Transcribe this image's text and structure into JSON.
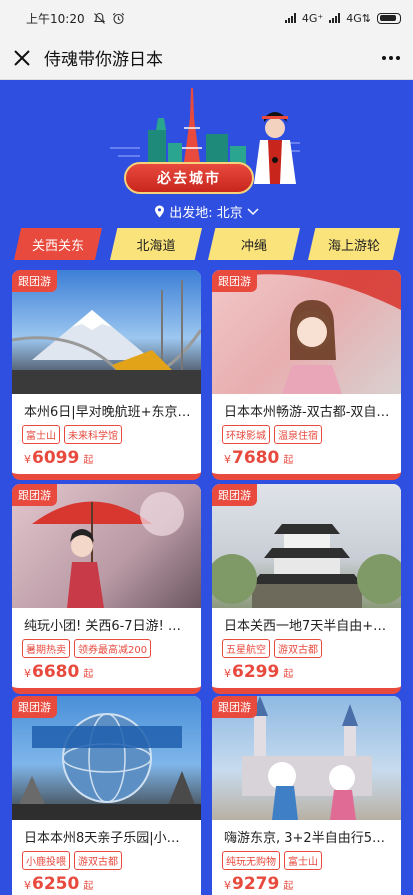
{
  "status": {
    "time": "上午10:20",
    "network1": "4G⁺",
    "network2": "4G⇅"
  },
  "titlebar": {
    "title": "侍魂带你游日本"
  },
  "banner": {
    "dest_label": "必去城市",
    "depart_label": "出发地: 北京"
  },
  "tabs": [
    {
      "label": "关西关东",
      "active": true
    },
    {
      "label": "北海道",
      "active": false
    },
    {
      "label": "冲绳",
      "active": false
    },
    {
      "label": "海上游轮",
      "active": false
    }
  ],
  "cards": [
    {
      "badge": "跟团游",
      "name": "本州6日|早对晚航班+东京…",
      "tags": [
        "富士山",
        "未来科学馆"
      ],
      "currency": "¥",
      "price": "6099",
      "unit": "起"
    },
    {
      "badge": "跟团游",
      "name": "日本本州畅游-双古都-双自…",
      "tags": [
        "环球影城",
        "温泉住宿"
      ],
      "currency": "¥",
      "price": "7680",
      "unit": "起"
    },
    {
      "badge": "跟团游",
      "name": "纯玩小团! 关西6-7日游! …",
      "tags": [
        "暑期热卖",
        "领券最高减200"
      ],
      "currency": "¥",
      "price": "6680",
      "unit": "起"
    },
    {
      "badge": "跟团游",
      "name": "日本关西一地7天半自由+…",
      "tags": [
        "五星航空",
        "游双古都"
      ],
      "currency": "¥",
      "price": "6299",
      "unit": "起"
    },
    {
      "badge": "跟团游",
      "name": "日本本州8天亲子乐园|小鹿…",
      "tags": [
        "小鹿投喂",
        "游双古都"
      ],
      "currency": "¥",
      "price": "6250",
      "unit": "起"
    },
    {
      "badge": "跟团游",
      "name": "嗨游东京, 3+2半自由行5…",
      "tags": [
        "纯玩无购物",
        "富士山"
      ],
      "currency": "¥",
      "price": "9279",
      "unit": "起"
    }
  ],
  "colors": {
    "background": "#2f4fe0",
    "accent": "#e84a3e",
    "tab_inactive": "#f9e37a"
  }
}
